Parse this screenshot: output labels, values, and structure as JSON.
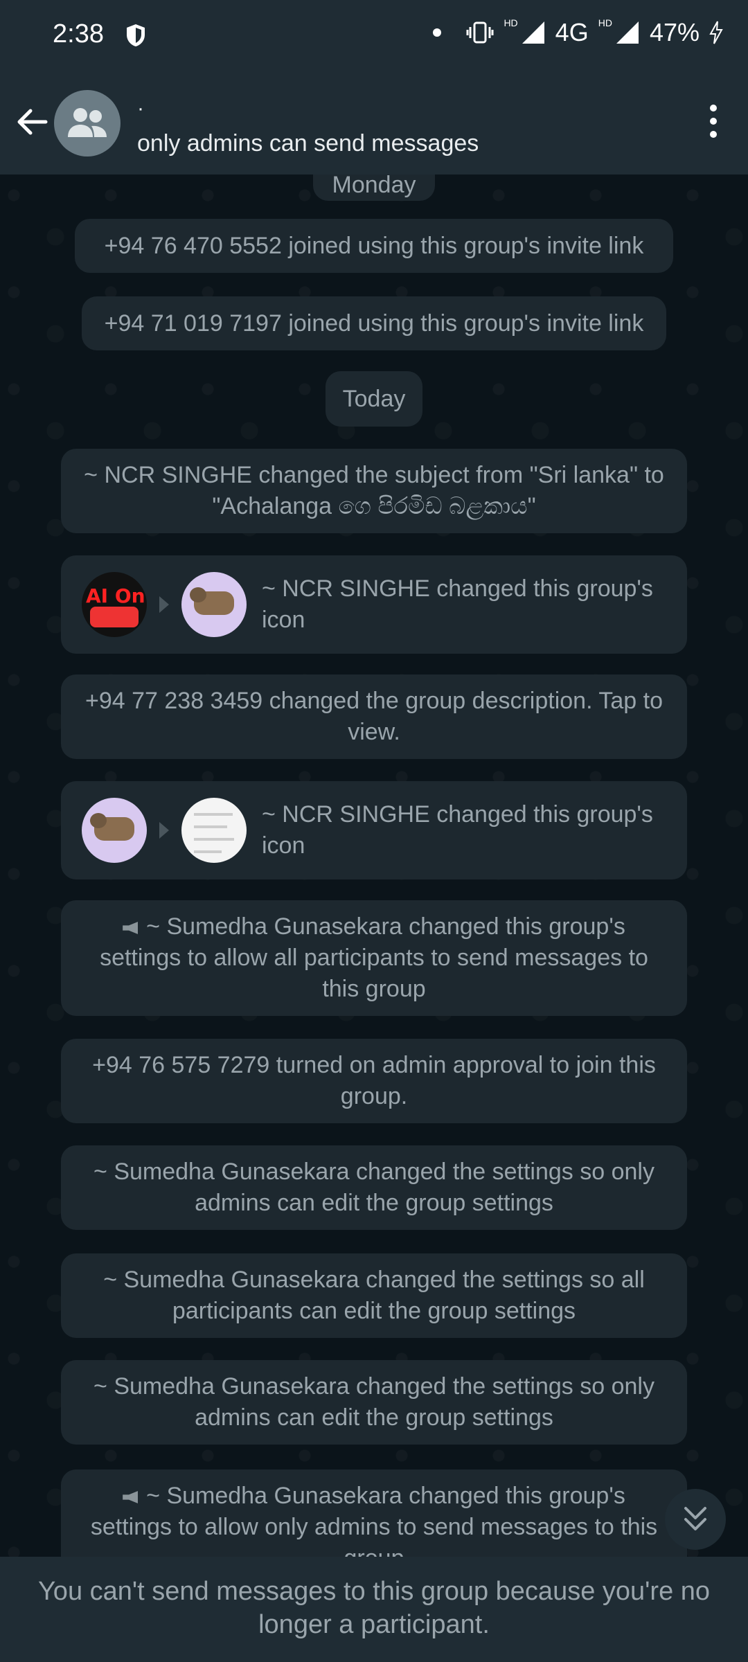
{
  "status_bar": {
    "time": "2:38",
    "network": "4G",
    "hd_badge": "HD",
    "battery": "47%",
    "icons": [
      "shield-icon",
      "vibrate-icon",
      "signal-icon",
      "battery-charging-icon"
    ]
  },
  "header": {
    "group_name": "·",
    "subtitle": "only admins can send messages"
  },
  "messages": {
    "date_monday": "Monday",
    "join1": "+94 76 470 5552 joined using this group's invite link",
    "join2": "+94 71 019 7197 joined using this group's invite link",
    "date_today": "Today",
    "subject_change": "~ NCR SINGHE changed the subject from \"Sri lanka\" to \"Achalanga ගෙ පිරමිඩ බළකාය\"",
    "icon_change1": "~ NCR SINGHE changed this group's icon",
    "desc_change": "+94 77 238 3459 changed the group description. Tap to view.",
    "icon_change2": "~ NCR SINGHE changed this group's icon",
    "settings_all_send": "~ Sumedha Gunasekara changed this group's settings to allow all participants to send messages to this group",
    "admin_approval": "+94 76 575 7279 turned on admin approval to join this group.",
    "only_admins_edit1": "~ Sumedha Gunasekara changed the settings so only admins can edit the group settings",
    "all_edit": "~ Sumedha Gunasekara changed the settings so all participants can edit the group settings",
    "only_admins_edit2": "~ Sumedha Gunasekara changed the settings so only admins can edit the group settings",
    "settings_only_admins_send": "~ Sumedha Gunasekara changed this group's settings to allow only admins to send messages to this group"
  },
  "icon_images": {
    "old_icon_text": "AI On"
  },
  "footer": {
    "notice": "You can't send messages to this group because you're no longer a participant."
  }
}
